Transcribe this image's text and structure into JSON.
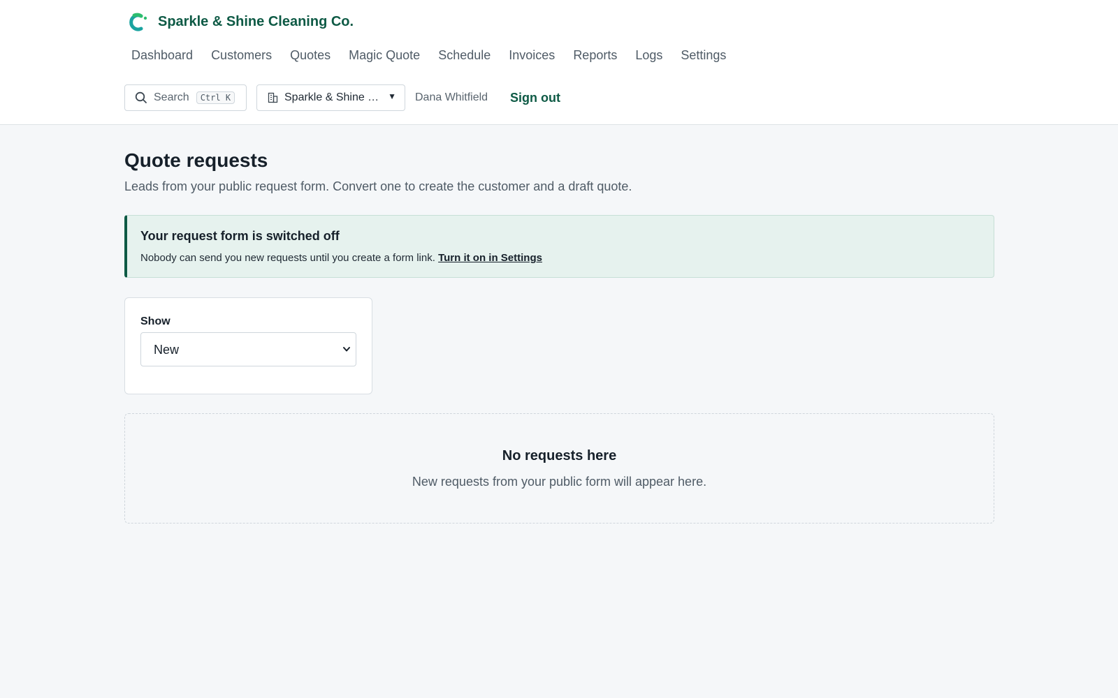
{
  "brand": {
    "name": "Sparkle & Shine Cleaning Co."
  },
  "nav": {
    "items": [
      "Dashboard",
      "Customers",
      "Quotes",
      "Magic Quote",
      "Schedule",
      "Invoices",
      "Reports",
      "Logs",
      "Settings"
    ]
  },
  "toolbar": {
    "search_label": "Search",
    "search_shortcut": "Ctrl K",
    "org_label": "Sparkle & Shine …",
    "user_name": "Dana Whitfield",
    "sign_out": "Sign out"
  },
  "page": {
    "title": "Quote requests",
    "subtitle": "Leads from your public request form. Convert one to create the customer and a draft quote."
  },
  "alert": {
    "title": "Your request form is switched off",
    "body": "Nobody can send you new requests until you create a form link.",
    "link": "Turn it on in Settings"
  },
  "filter": {
    "label": "Show",
    "selected": "New"
  },
  "empty_state": {
    "title": "No requests here",
    "body": "New requests from your public form will appear here."
  },
  "colors": {
    "brand": "#0e5a45",
    "logo_teal": "#1aa3a0",
    "logo_green": "#2dbd6e",
    "alert_bg": "#e6f2ee",
    "page_bg": "#f5f7f9"
  }
}
